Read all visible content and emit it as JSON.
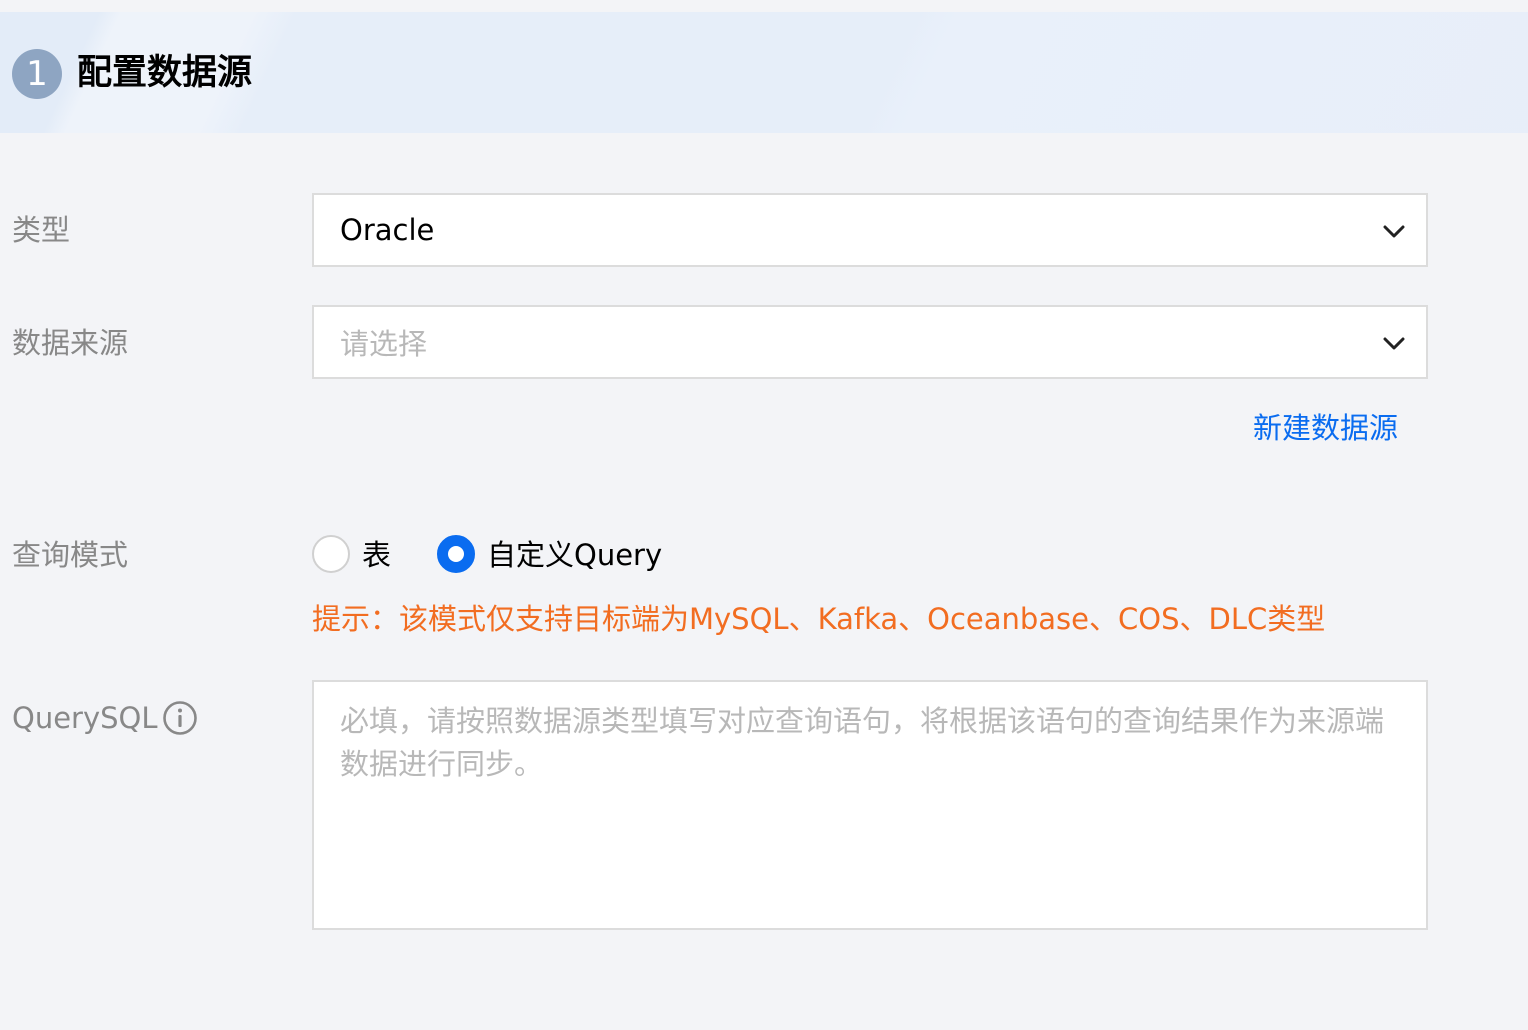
{
  "section": {
    "step_number": "1",
    "title": "配置数据源"
  },
  "form": {
    "type_label": "类型",
    "type_value": "Oracle",
    "source_label": "数据来源",
    "source_placeholder": "请选择",
    "new_source_link": "新建数据源",
    "query_mode_label": "查询模式",
    "query_mode_options": [
      {
        "label": "表",
        "selected": false
      },
      {
        "label": "自定义Query",
        "selected": true
      }
    ],
    "tip": "提示：该模式仅支持目标端为MySQL、Kafka、Oceanbase、COS、DLC类型",
    "querysql_label": "QuerySQL",
    "querysql_placeholder": "必填，请按照数据源类型填写对应查询语句，将根据该语句的查询结果作为来源端数据进行同步。"
  },
  "colors": {
    "accent": "#0a6cf0",
    "tip": "#f26d21",
    "badge": "#8ea5c2",
    "label": "#888888",
    "placeholder": "#b8b8b8"
  },
  "icons": {
    "dropdown": "chevron-down-icon",
    "info": "info-circle-icon"
  }
}
